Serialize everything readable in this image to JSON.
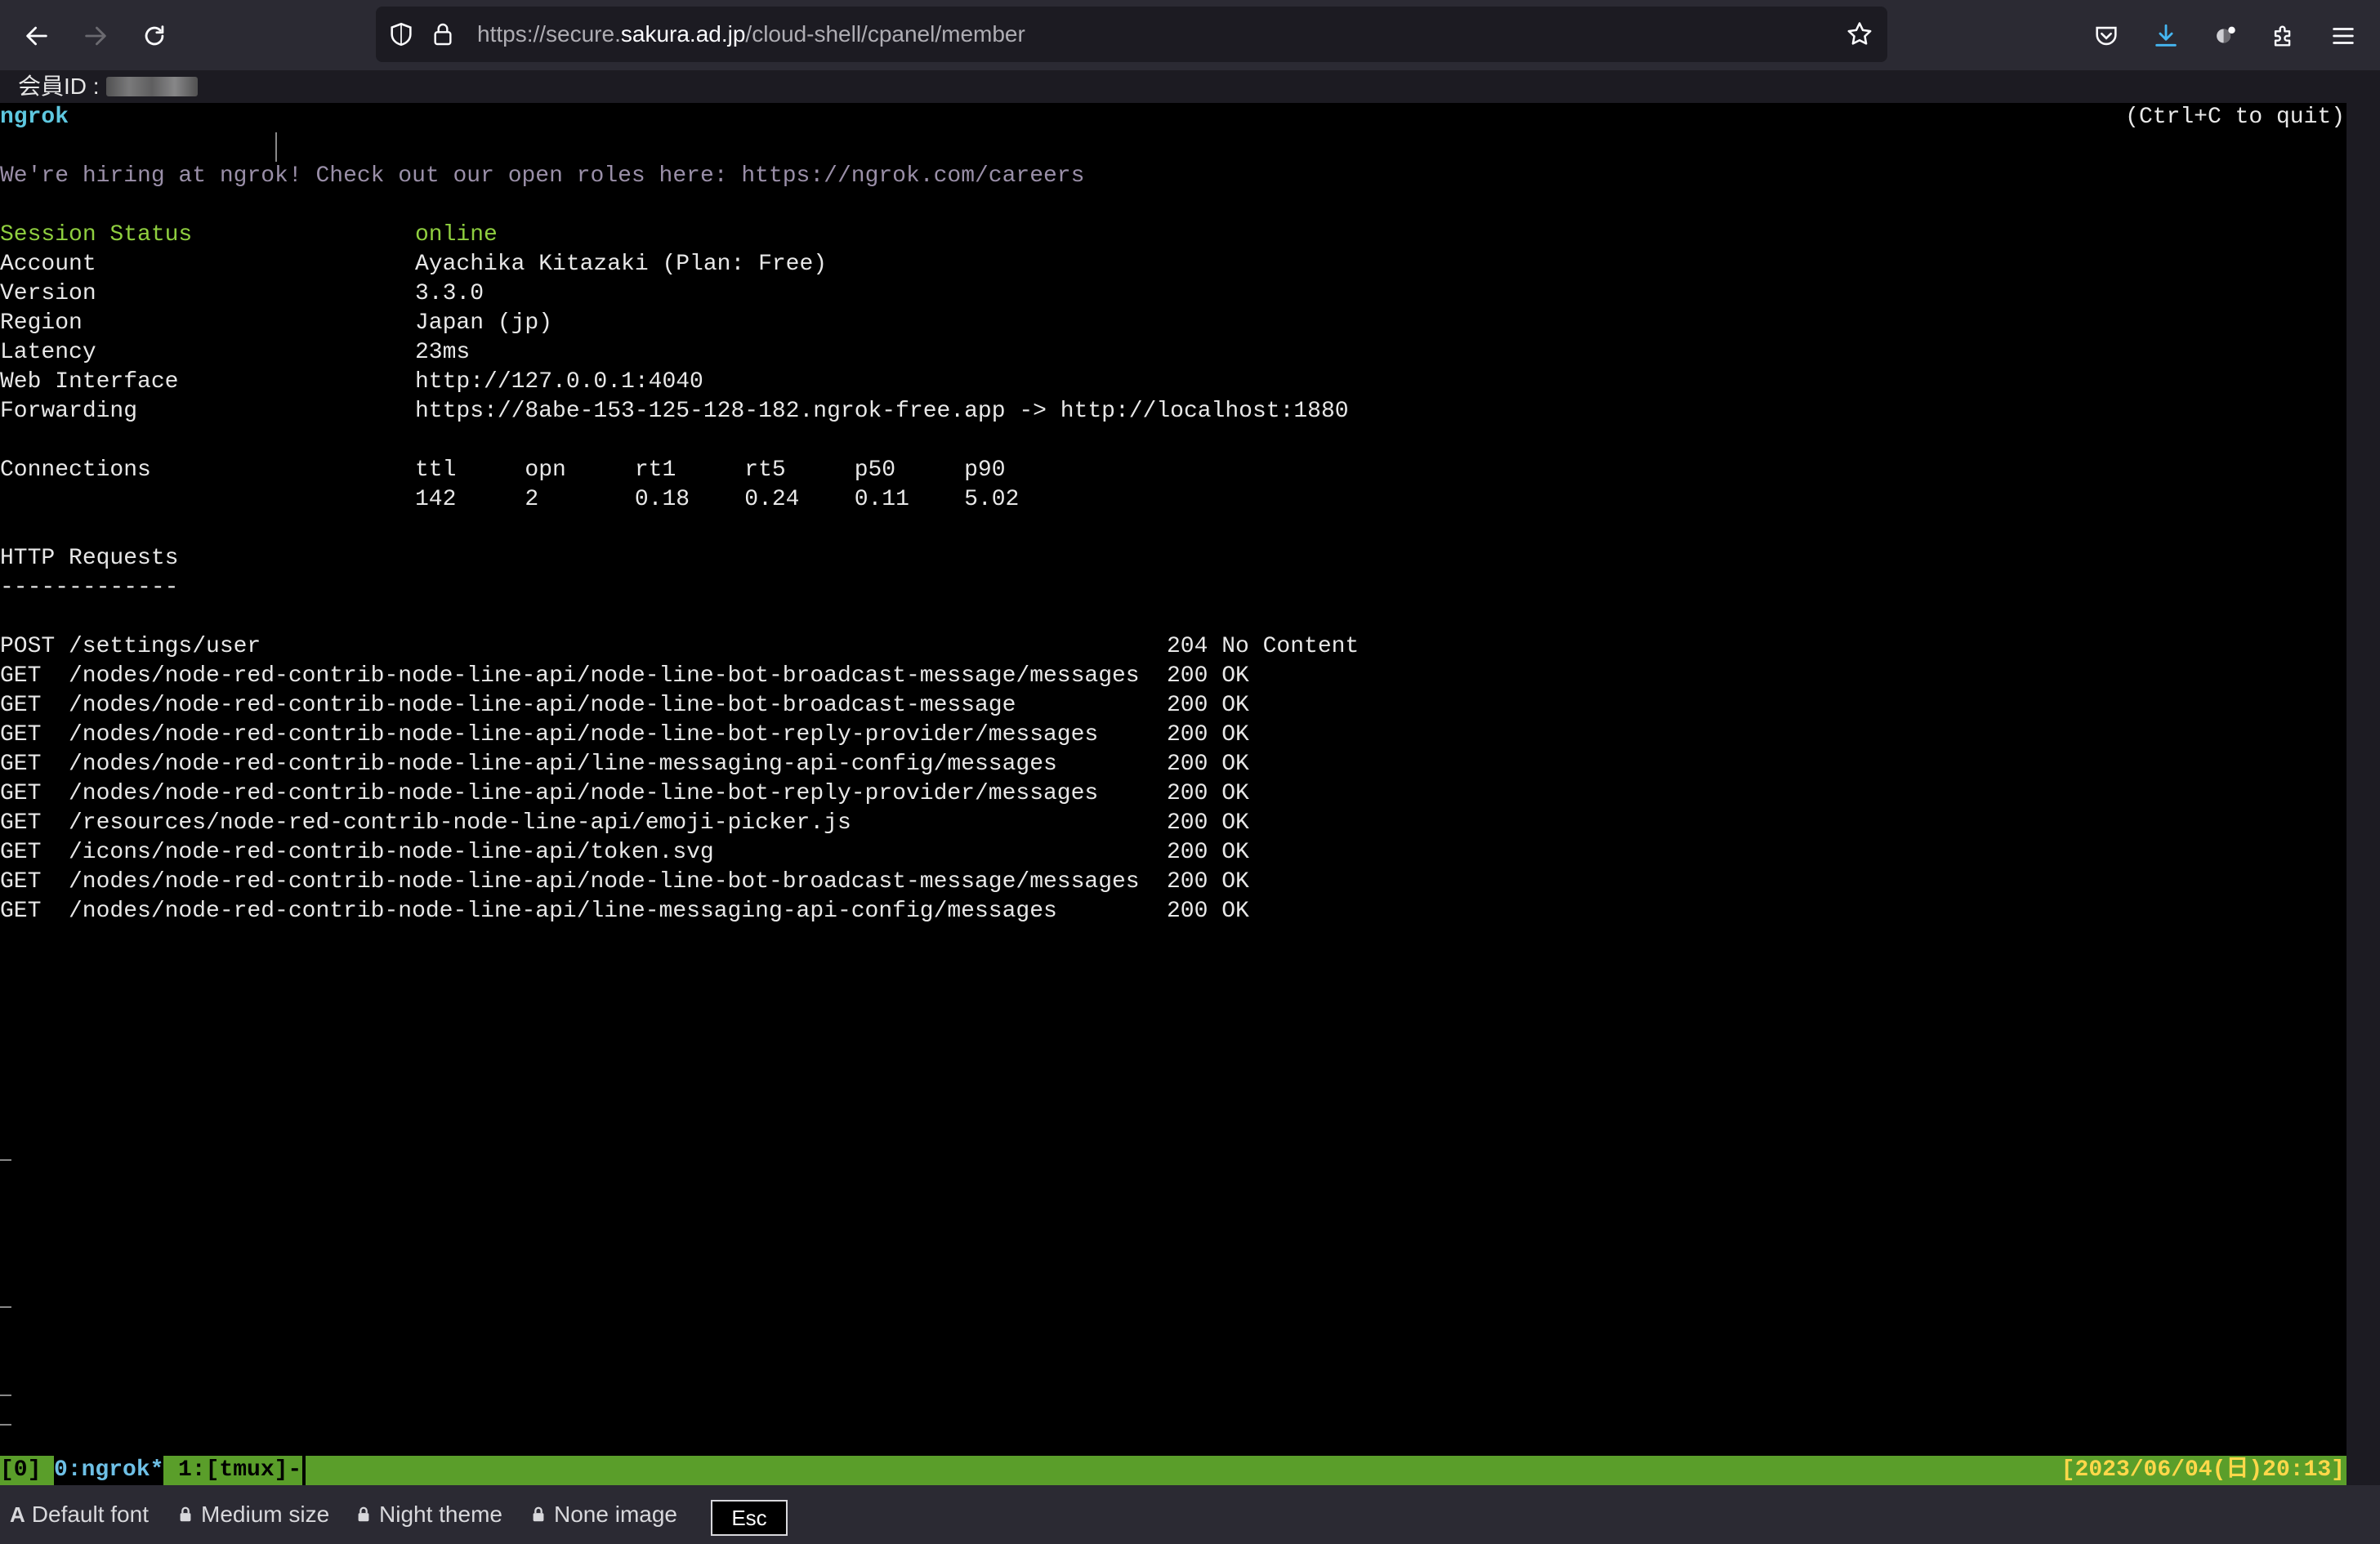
{
  "browser": {
    "url_prefix": "https://secure.",
    "url_domain": "sakura.ad.jp",
    "url_path": "/cloud-shell/cpanel/member"
  },
  "member": {
    "label": "会員ID :"
  },
  "terminal": {
    "app_name": "ngrok",
    "quit_hint": "(Ctrl+C to quit)",
    "hiring": "We're hiring at ngrok! Check out our open roles here: https://ngrok.com/careers",
    "info": [
      {
        "label": "Session Status",
        "value": "online"
      },
      {
        "label": "Account",
        "value": "Ayachika Kitazaki (Plan: Free)"
      },
      {
        "label": "Version",
        "value": "3.3.0"
      },
      {
        "label": "Region",
        "value": "Japan (jp)"
      },
      {
        "label": "Latency",
        "value": "23ms"
      },
      {
        "label": "Web Interface",
        "value": "http://127.0.0.1:4040"
      },
      {
        "label": "Forwarding",
        "value": "https://8abe-153-125-128-182.ngrok-free.app -> http://localhost:1880"
      }
    ],
    "connections": {
      "label": "Connections",
      "headers": "ttl     opn     rt1     rt5     p50     p90",
      "values": "142     2       0.18    0.24    0.11    5.02"
    },
    "http_title": "HTTP Requests",
    "http_rule": "-------------",
    "requests": [
      {
        "method": "POST",
        "path": "/settings/user",
        "status": "204 No Content"
      },
      {
        "method": "GET",
        "path": "/nodes/node-red-contrib-node-line-api/node-line-bot-broadcast-message/messages",
        "status": "200 OK"
      },
      {
        "method": "GET",
        "path": "/nodes/node-red-contrib-node-line-api/node-line-bot-broadcast-message",
        "status": "200 OK"
      },
      {
        "method": "GET",
        "path": "/nodes/node-red-contrib-node-line-api/node-line-bot-reply-provider/messages",
        "status": "200 OK"
      },
      {
        "method": "GET",
        "path": "/nodes/node-red-contrib-node-line-api/line-messaging-api-config/messages",
        "status": "200 OK"
      },
      {
        "method": "GET",
        "path": "/nodes/node-red-contrib-node-line-api/node-line-bot-reply-provider/messages",
        "status": "200 OK"
      },
      {
        "method": "GET",
        "path": "/resources/node-red-contrib-node-line-api/emoji-picker.js",
        "status": "200 OK"
      },
      {
        "method": "GET",
        "path": "/icons/node-red-contrib-node-line-api/token.svg",
        "status": "200 OK"
      },
      {
        "method": "GET",
        "path": "/nodes/node-red-contrib-node-line-api/node-line-bot-broadcast-message/messages",
        "status": "200 OK"
      },
      {
        "method": "GET",
        "path": "/nodes/node-red-contrib-node-line-api/line-messaging-api-config/messages",
        "status": "200 OK"
      }
    ]
  },
  "tmux": {
    "session": "[0]",
    "window0": "0:ngrok*",
    "window1": "1:[tmux]-",
    "clock": "[2023/06/04(日)20:13]"
  },
  "options": {
    "font": "Default font",
    "size": "Medium size",
    "theme": "Night theme",
    "image": "None image",
    "esc": "Esc"
  },
  "colors": {
    "terminal_bg": "#000000",
    "status_green": "#8fcf3f",
    "tmux_bar": "#5a9e2a",
    "hiring_text": "#9a8fa8",
    "ngrok_title": "#5ec8e0"
  }
}
